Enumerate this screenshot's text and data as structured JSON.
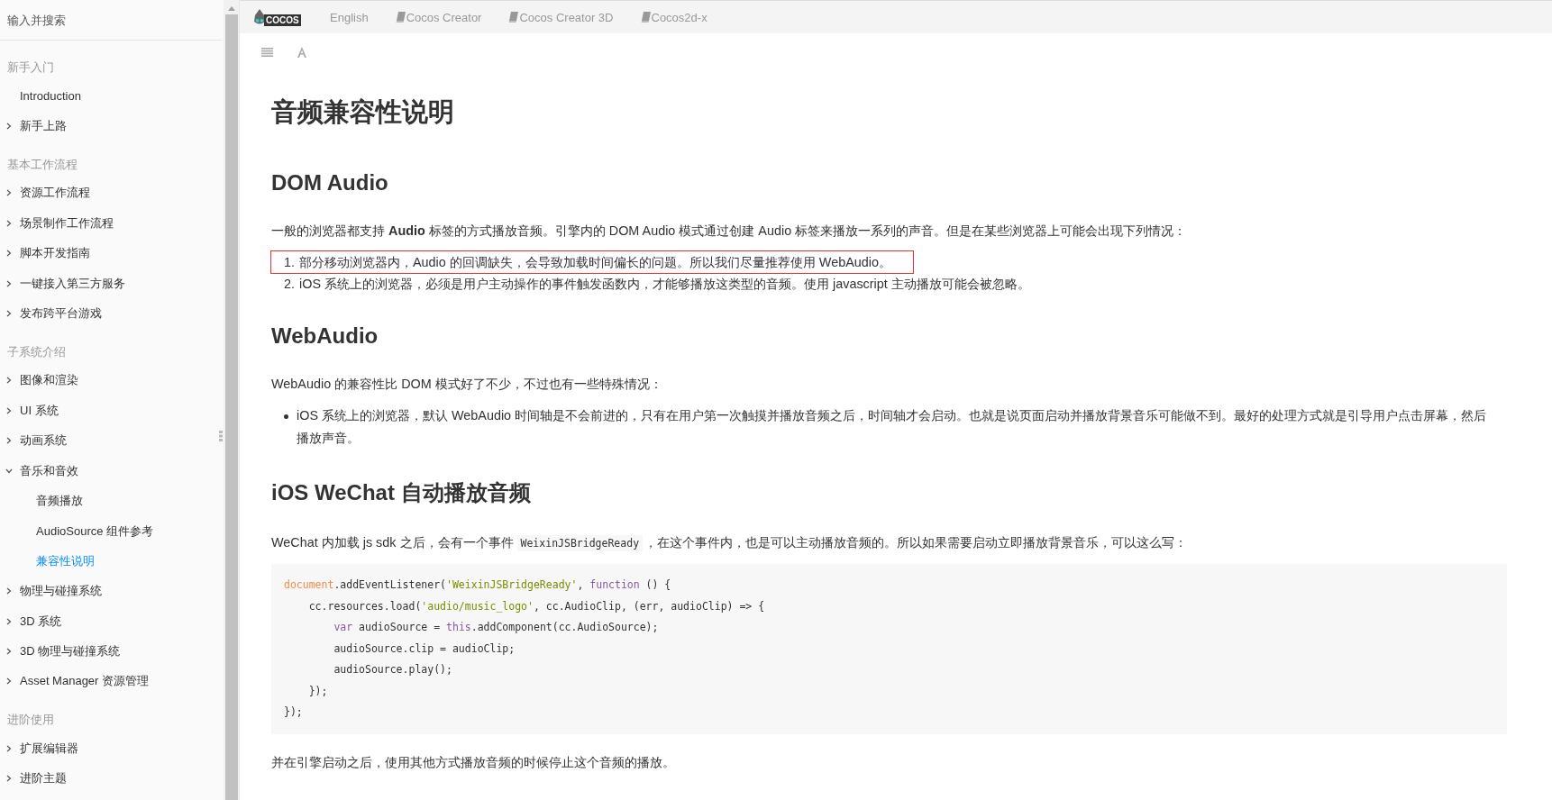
{
  "sidebar": {
    "search": {
      "placeholder": "输入并搜索"
    },
    "sections": [
      {
        "title": "新手入门",
        "items": [
          {
            "label": "Introduction",
            "kind": "leaf",
            "selected": false
          },
          {
            "label": "新手上路",
            "kind": "folder",
            "expanded": false,
            "selected": false
          }
        ]
      },
      {
        "title": "基本工作流程",
        "items": [
          {
            "label": "资源工作流程",
            "kind": "folder",
            "expanded": false,
            "selected": false
          },
          {
            "label": "场景制作工作流程",
            "kind": "folder",
            "expanded": false,
            "selected": false
          },
          {
            "label": "脚本开发指南",
            "kind": "folder",
            "expanded": false,
            "selected": false
          },
          {
            "label": "一键接入第三方服务",
            "kind": "folder",
            "expanded": false,
            "selected": false
          },
          {
            "label": "发布跨平台游戏",
            "kind": "folder",
            "expanded": false,
            "selected": false
          }
        ]
      },
      {
        "title": "子系统介绍",
        "items": [
          {
            "label": "图像和渲染",
            "kind": "folder",
            "expanded": false,
            "selected": false
          },
          {
            "label": "UI 系统",
            "kind": "folder",
            "expanded": false,
            "selected": false
          },
          {
            "label": "动画系统",
            "kind": "folder",
            "expanded": false,
            "selected": false
          },
          {
            "label": "音乐和音效",
            "kind": "folder",
            "expanded": true,
            "selected": false,
            "children": [
              {
                "label": "音频播放",
                "selected": false
              },
              {
                "label": "AudioSource 组件参考",
                "selected": false
              },
              {
                "label": "兼容性说明",
                "selected": true
              }
            ]
          },
          {
            "label": "物理与碰撞系统",
            "kind": "folder",
            "expanded": false,
            "selected": false
          },
          {
            "label": "3D 系统",
            "kind": "folder",
            "expanded": false,
            "selected": false
          },
          {
            "label": "3D 物理与碰撞系统",
            "kind": "folder",
            "expanded": false,
            "selected": false
          },
          {
            "label": "Asset Manager 资源管理",
            "kind": "folder",
            "expanded": false,
            "selected": false
          }
        ]
      },
      {
        "title": "进阶使用",
        "items": [
          {
            "label": "扩展编辑器",
            "kind": "folder",
            "expanded": false,
            "selected": false
          },
          {
            "label": "进阶主题",
            "kind": "folder",
            "expanded": false,
            "selected": false
          }
        ]
      }
    ]
  },
  "topbar": {
    "logo": "COCOS",
    "links": [
      {
        "label": "English",
        "kind": "plain"
      },
      {
        "label": "Cocos Creator",
        "kind": "book"
      },
      {
        "label": "Cocos Creator 3D",
        "kind": "book"
      },
      {
        "label": "Cocos2d-x",
        "kind": "book"
      }
    ]
  },
  "article": {
    "title": "音频兼容性说明",
    "blocks": [
      {
        "kind": "h2",
        "text": "DOM Audio"
      },
      {
        "kind": "p",
        "text": "一般的浏览器都支持 **Audio** 标签的方式播放音频。引擎内的 DOM Audio 模式通过创建 Audio 标签来播放一系列的声音。但是在某些浏览器上可能会出现下列情况："
      },
      {
        "kind": "ol",
        "items": [
          {
            "marker": "1.",
            "text": "部分移动浏览器内，Audio 的回调缺失，会导致加载时间偏长的问题。所以我们尽量推荐使用 WebAudio。",
            "highlighted": true
          },
          {
            "marker": "2.",
            "text": "iOS 系统上的浏览器，必须是用户主动操作的事件触发函数内，才能够播放这类型的音频。使用 javascript 主动播放可能会被忽略。",
            "highlighted": false
          }
        ]
      },
      {
        "kind": "h2",
        "text": "WebAudio"
      },
      {
        "kind": "p",
        "text": "WebAudio 的兼容性比 DOM 模式好了不少，不过也有一些特殊情况："
      },
      {
        "kind": "ul",
        "items": [
          {
            "text": "iOS 系统上的浏览器，默认 WebAudio 时间轴是不会前进的，只有在用户第一次触摸并播放音频之后，时间轴才会启动。也就是说页面启动并播放背景音乐可能做不到。最好的处理方式就是引导用户点击屏幕，然后播放声音。",
            "highlighted": false
          }
        ]
      },
      {
        "kind": "h2",
        "text": "iOS WeChat 自动播放音频"
      },
      {
        "kind": "p_code",
        "before": "WeChat 内加载 js sdk 之后，会有一个事件",
        "code": "WeixinJSBridgeReady",
        "after": "，在这个事件内，也是可以主动播放音频的。所以如果需要启动立即播放背景音乐，可以这么写："
      },
      {
        "kind": "code",
        "lines": [
          [
            {
              "t": "document",
              "kind": "builtin"
            },
            {
              "t": ".addEventListener(",
              "kind": "plain"
            },
            {
              "t": "'WeixinJSBridgeReady'",
              "kind": "string"
            },
            {
              "t": ", ",
              "kind": "plain"
            },
            {
              "t": "function",
              "kind": "keyword"
            },
            {
              "t": " () {",
              "kind": "plain"
            }
          ],
          [
            {
              "t": "    cc.resources.load(",
              "kind": "plain"
            },
            {
              "t": "'audio/music_logo'",
              "kind": "string"
            },
            {
              "t": ", cc.AudioClip, (err, audioClip) => {",
              "kind": "plain"
            }
          ],
          [
            {
              "t": "        var",
              "kind": "keyword"
            },
            {
              "t": " audioSource = ",
              "kind": "plain"
            },
            {
              "t": "this",
              "kind": "keyword"
            },
            {
              "t": ".addComponent(cc.AudioSource);",
              "kind": "plain"
            }
          ],
          [
            {
              "t": "        audioSource.clip = audioClip;",
              "kind": "plain"
            }
          ],
          [
            {
              "t": "        audioSource.play();",
              "kind": "plain"
            }
          ],
          [
            {
              "t": "    });",
              "kind": "plain"
            }
          ],
          [
            {
              "t": "});",
              "kind": "plain"
            }
          ]
        ]
      },
      {
        "kind": "p",
        "text": "并在引擎启动之后，使用其他方式播放音频的时候停止这个音频的播放。"
      }
    ]
  }
}
